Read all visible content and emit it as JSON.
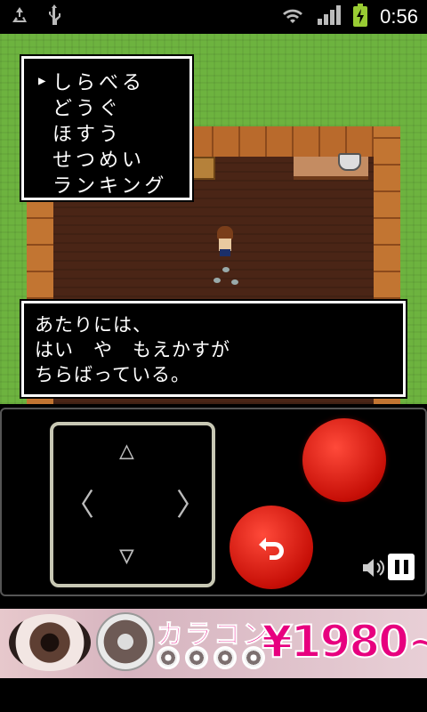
{
  "status_bar": {
    "icons": [
      "recycle-icon",
      "usb-icon",
      "wifi-icon",
      "signal-icon",
      "battery-charging-icon"
    ],
    "time": "0:56"
  },
  "menu": {
    "items": [
      "しらべる",
      "どうぐ",
      "ほすう",
      "せつめい",
      "ランキング"
    ],
    "selected_index": 0
  },
  "message": {
    "lines": [
      "あたりには、",
      "はい　や　もえかすが",
      "ちらばっている。"
    ]
  },
  "controls": {
    "dpad_icon": "dpad-icon",
    "a_button_icon": "a-button-icon",
    "b_button_icon": "back-arrow-icon",
    "sound_icon": "speaker-icon",
    "pause_icon": "pause-icon"
  },
  "ad": {
    "title": "カラコン",
    "price": "¥1980~"
  },
  "colors": {
    "grass": "#6db33f",
    "floor": "#4a2516",
    "button_red": "#c70f07",
    "ad_pink": "#e7007f"
  }
}
